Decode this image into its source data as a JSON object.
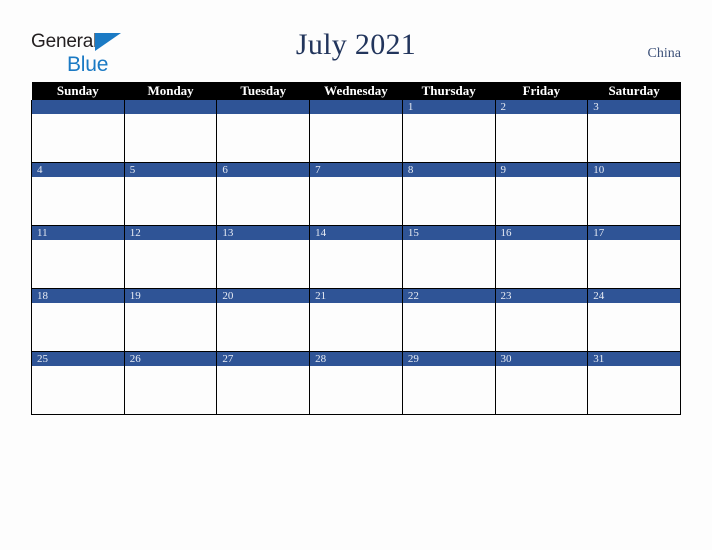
{
  "brand": {
    "name_part1": "General",
    "name_part2": "Blue",
    "triangle_color": "#1b7ac4",
    "text_color": "#231f20"
  },
  "header": {
    "title": "July 2021",
    "country": "China",
    "title_color": "#22355c",
    "country_color": "#3d5179"
  },
  "calendar": {
    "month": "July",
    "year": "2021",
    "header_bg": "#000000",
    "header_text_color": "#ffffff",
    "date_band_color": "#2f5496",
    "date_text_color": "#e8ecf4",
    "cell_bg": "#fdfdfd",
    "grid_line_color": "#000000",
    "weekdays": [
      "Sunday",
      "Monday",
      "Tuesday",
      "Wednesday",
      "Thursday",
      "Friday",
      "Saturday"
    ],
    "weeks": [
      [
        "",
        "",
        "",
        "",
        "1",
        "2",
        "3"
      ],
      [
        "4",
        "5",
        "6",
        "7",
        "8",
        "9",
        "10"
      ],
      [
        "11",
        "12",
        "13",
        "14",
        "15",
        "16",
        "17"
      ],
      [
        "18",
        "19",
        "20",
        "21",
        "22",
        "23",
        "24"
      ],
      [
        "25",
        "26",
        "27",
        "28",
        "29",
        "30",
        "31"
      ]
    ]
  }
}
